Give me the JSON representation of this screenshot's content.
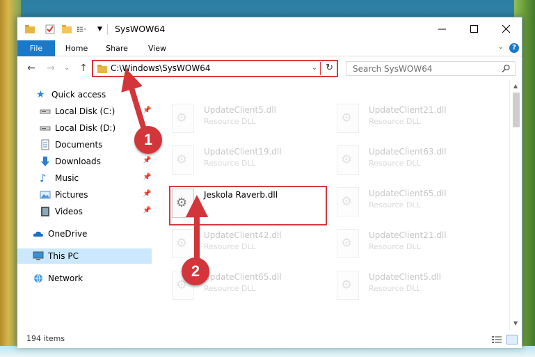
{
  "window": {
    "title": "SysWOW64"
  },
  "ribbon": {
    "tabs": [
      "File",
      "Home",
      "Share",
      "View"
    ],
    "help_label": "?"
  },
  "navigation": {
    "address_path": "C:\\Windows\\SysWOW64",
    "search_placeholder": "Search SysWOW64"
  },
  "sidebar": {
    "quick_access": "Quick access",
    "items": [
      {
        "label": "Local Disk (C:)",
        "icon": "drive-icon",
        "pinned": true
      },
      {
        "label": "Local Disk (D:)",
        "icon": "drive-icon",
        "pinned": false
      },
      {
        "label": "Documents",
        "icon": "documents-icon",
        "pinned": false
      },
      {
        "label": "Downloads",
        "icon": "downloads-icon",
        "pinned": true
      },
      {
        "label": "Music",
        "icon": "music-icon",
        "pinned": true
      },
      {
        "label": "Pictures",
        "icon": "pictures-icon",
        "pinned": true
      },
      {
        "label": "Videos",
        "icon": "videos-icon",
        "pinned": true
      }
    ],
    "onedrive": "OneDrive",
    "this_pc": "This PC",
    "network": "Network"
  },
  "files": [
    {
      "name": "UpdateClient5.dll",
      "type": "Resource DLL"
    },
    {
      "name": "UpdateClient21.dll",
      "type": "Resource DLL"
    },
    {
      "name": "UpdateClient19.dll",
      "type": "Resource DLL"
    },
    {
      "name": "UpdateClient63.dll",
      "type": "Resource DLL"
    },
    {
      "name": "Jeskola Raverb.dll",
      "type": ""
    },
    {
      "name": "UpdateClient65.dll",
      "type": "Resource DLL"
    },
    {
      "name": "UpdateClient42.dll",
      "type": "Resource DLL"
    },
    {
      "name": "UpdateClient21.dll",
      "type": "Resource DLL"
    },
    {
      "name": "UpdateClient65.dll",
      "type": "Resource DLL"
    },
    {
      "name": "UpdateClient5.dll",
      "type": "Resource DLL"
    }
  ],
  "status": {
    "item_count": "194 items"
  },
  "annotations": {
    "step1": "1",
    "step2": "2"
  },
  "colors": {
    "accent": "#1979ca",
    "annotation_red": "#d9393d",
    "selection": "#cce8ff"
  }
}
